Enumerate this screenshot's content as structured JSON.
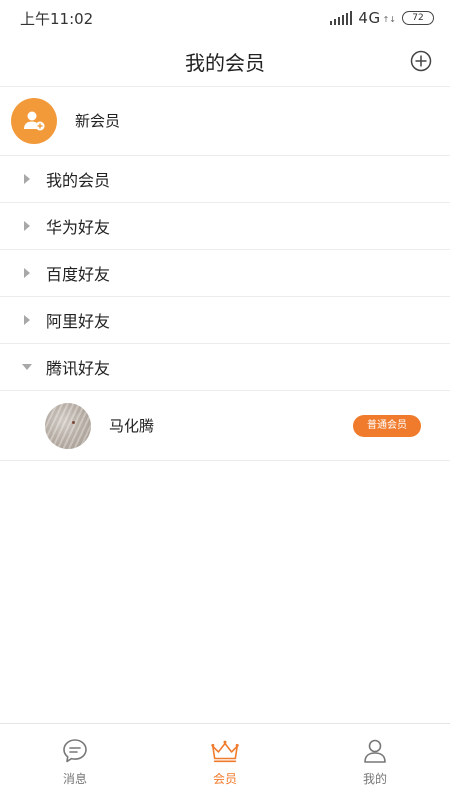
{
  "status_bar": {
    "time": "上午11:02",
    "network": "4G",
    "network_sub": "↑↓",
    "battery": "72"
  },
  "header": {
    "title": "我的会员"
  },
  "new_member": {
    "label": "新会员"
  },
  "groups": [
    {
      "label": "我的会员",
      "expanded": false
    },
    {
      "label": "华为好友",
      "expanded": false
    },
    {
      "label": "百度好友",
      "expanded": false
    },
    {
      "label": "阿里好友",
      "expanded": false
    },
    {
      "label": "腾讯好友",
      "expanded": true
    }
  ],
  "members": [
    {
      "name": "马化腾",
      "badge": "普通会员"
    }
  ],
  "bottom_nav": {
    "items": [
      {
        "label": "消息",
        "icon": "chat-icon",
        "active": false
      },
      {
        "label": "会员",
        "icon": "crown-icon",
        "active": true
      },
      {
        "label": "我的",
        "icon": "person-icon",
        "active": false
      }
    ]
  },
  "colors": {
    "accent": "#f07b2c",
    "avatar_orange": "#f29a3a",
    "inactive_icon": "#777777"
  }
}
